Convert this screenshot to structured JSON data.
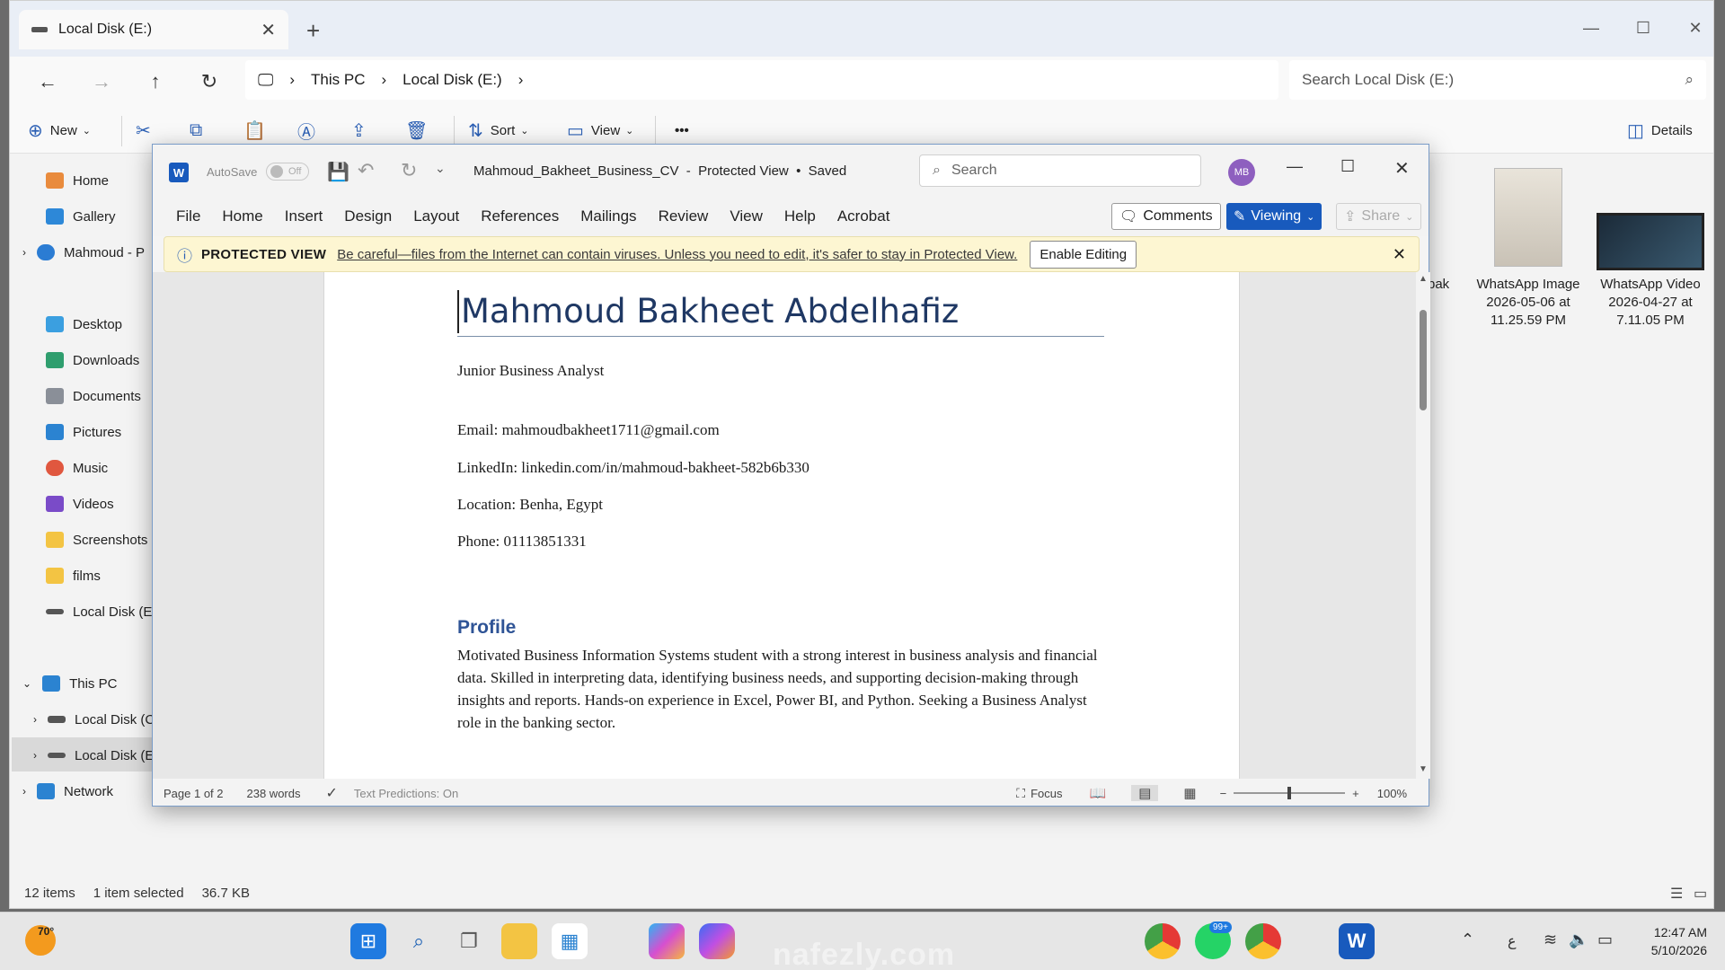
{
  "explorer": {
    "tab_title": "Local Disk (E:)",
    "breadcrumb": [
      "This PC",
      "Local Disk (E:)"
    ],
    "search_placeholder": "Search Local Disk (E:)",
    "toolbar": {
      "new": "New",
      "sort": "Sort",
      "view": "View",
      "more": "•••",
      "details": "Details"
    },
    "sidebar": {
      "home": "Home",
      "gallery": "Gallery",
      "onedrive": "Mahmoud - P",
      "desktop": "Desktop",
      "downloads": "Downloads",
      "documents": "Documents",
      "pictures": "Pictures",
      "music": "Music",
      "videos": "Videos",
      "screenshots": "Screenshots",
      "films": "films",
      "local_e": "Local Disk (E:)",
      "this_pc": "This PC",
      "local_c": "Local Disk (C",
      "local_e2": "Local Disk (E",
      "network": "Network"
    },
    "files": [
      {
        "name": "bak"
      },
      {
        "name": "WhatsApp Image 2026-05-06 at 11.25.59 PM"
      },
      {
        "name": "WhatsApp Video 2026-04-27 at 7.11.05 PM"
      }
    ],
    "status": {
      "items": "12 items",
      "selected": "1 item selected",
      "size": "36.7 KB"
    }
  },
  "word": {
    "autosave": "AutoSave",
    "autosave_state": "Off",
    "doc_title": "Mahmoud_Bakheet_Business_CV  -  Protected View  •  Saved",
    "search": "Search",
    "avatar": "MB",
    "menu": [
      "File",
      "Home",
      "Insert",
      "Design",
      "Layout",
      "References",
      "Mailings",
      "Review",
      "View",
      "Help",
      "Acrobat"
    ],
    "comments": "Comments",
    "viewing": "Viewing",
    "share": "Share",
    "protected_label": "PROTECTED VIEW",
    "protected_msg": "Be careful—files from the Internet can contain viruses. Unless you need to edit, it's safer to stay in Protected View.",
    "enable_editing": "Enable Editing",
    "doc": {
      "name": "Mahmoud Bakheet Abdelhafiz",
      "role": "Junior Business Analyst",
      "email": "Email: mahmoudbakheet1711@gmail.com",
      "linkedin": "LinkedIn: linkedin.com/in/mahmoud-bakheet-582b6b330",
      "location": "Location: Benha, Egypt",
      "phone": "Phone: 01113851331",
      "profile_heading": "Profile",
      "profile_text": "Motivated Business Information Systems student with a strong interest in business analysis and financial data. Skilled in interpreting data, identifying business needs, and supporting decision-making through insights and reports. Hands-on experience in Excel, Power BI, and Python. Seeking a Business Analyst role in the banking sector."
    },
    "status": {
      "page": "Page 1 of 2",
      "words": "238 words",
      "predictions": "Text Predictions: On",
      "focus": "Focus",
      "zoom": "100%"
    }
  },
  "taskbar": {
    "weather": "70°",
    "badge": "99+",
    "lang": "ع",
    "time": "12:47 AM",
    "date": "5/10/2026",
    "watermark": "nafezly.com"
  }
}
